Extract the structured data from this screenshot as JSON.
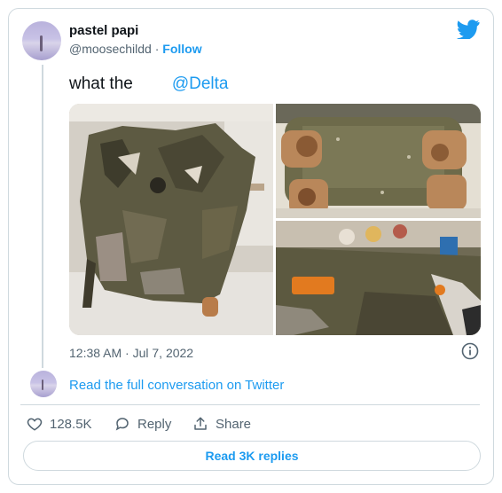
{
  "author": {
    "display_name": "pastel papi",
    "handle": "@moosechildd",
    "separator": "·",
    "follow_label": "Follow"
  },
  "tweet": {
    "text_prefix": "what the",
    "mention": "@Delta",
    "timestamp": "12:38 AM · Jul 7, 2022"
  },
  "conversation_link": "Read the full conversation on Twitter",
  "actions": {
    "likes": "128.5K",
    "reply_label": "Reply",
    "share_label": "Share"
  },
  "replies_button": "Read 3K replies",
  "colors": {
    "accent": "#1d9bf0",
    "muted_text": "#536471",
    "border": "#cfd9de"
  },
  "icons": [
    "twitter-bird-icon",
    "info-icon",
    "heart-icon",
    "reply-bubble-icon",
    "share-icon"
  ]
}
